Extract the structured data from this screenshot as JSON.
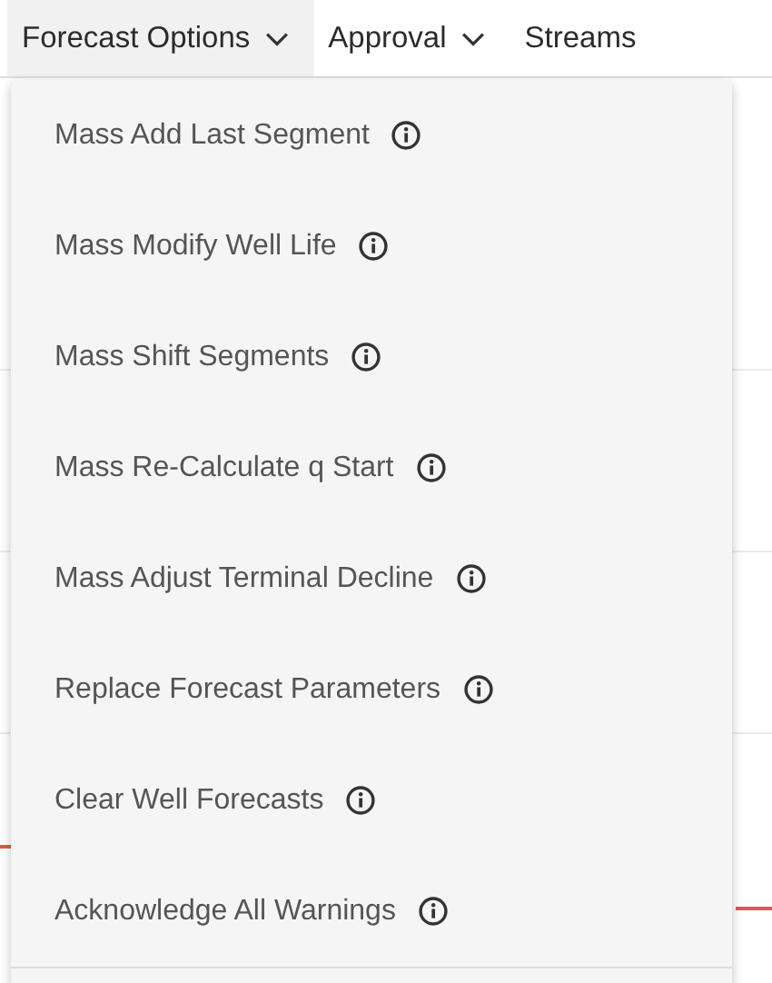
{
  "menu_bar": {
    "tabs": [
      {
        "label": "Forecast Options",
        "selected": true
      },
      {
        "label": "Approval",
        "selected": false
      },
      {
        "label": "Streams",
        "selected": false
      }
    ]
  },
  "dropdown": {
    "items": [
      {
        "label": "Mass Add Last Segment"
      },
      {
        "label": "Mass Modify Well Life"
      },
      {
        "label": "Mass Shift Segments"
      },
      {
        "label": "Mass Re-Calculate q Start"
      },
      {
        "label": "Mass Adjust Terminal Decline"
      },
      {
        "label": "Replace Forecast Parameters"
      },
      {
        "label": "Clear Well Forecasts"
      },
      {
        "label": "Acknowledge All Warnings"
      }
    ]
  }
}
